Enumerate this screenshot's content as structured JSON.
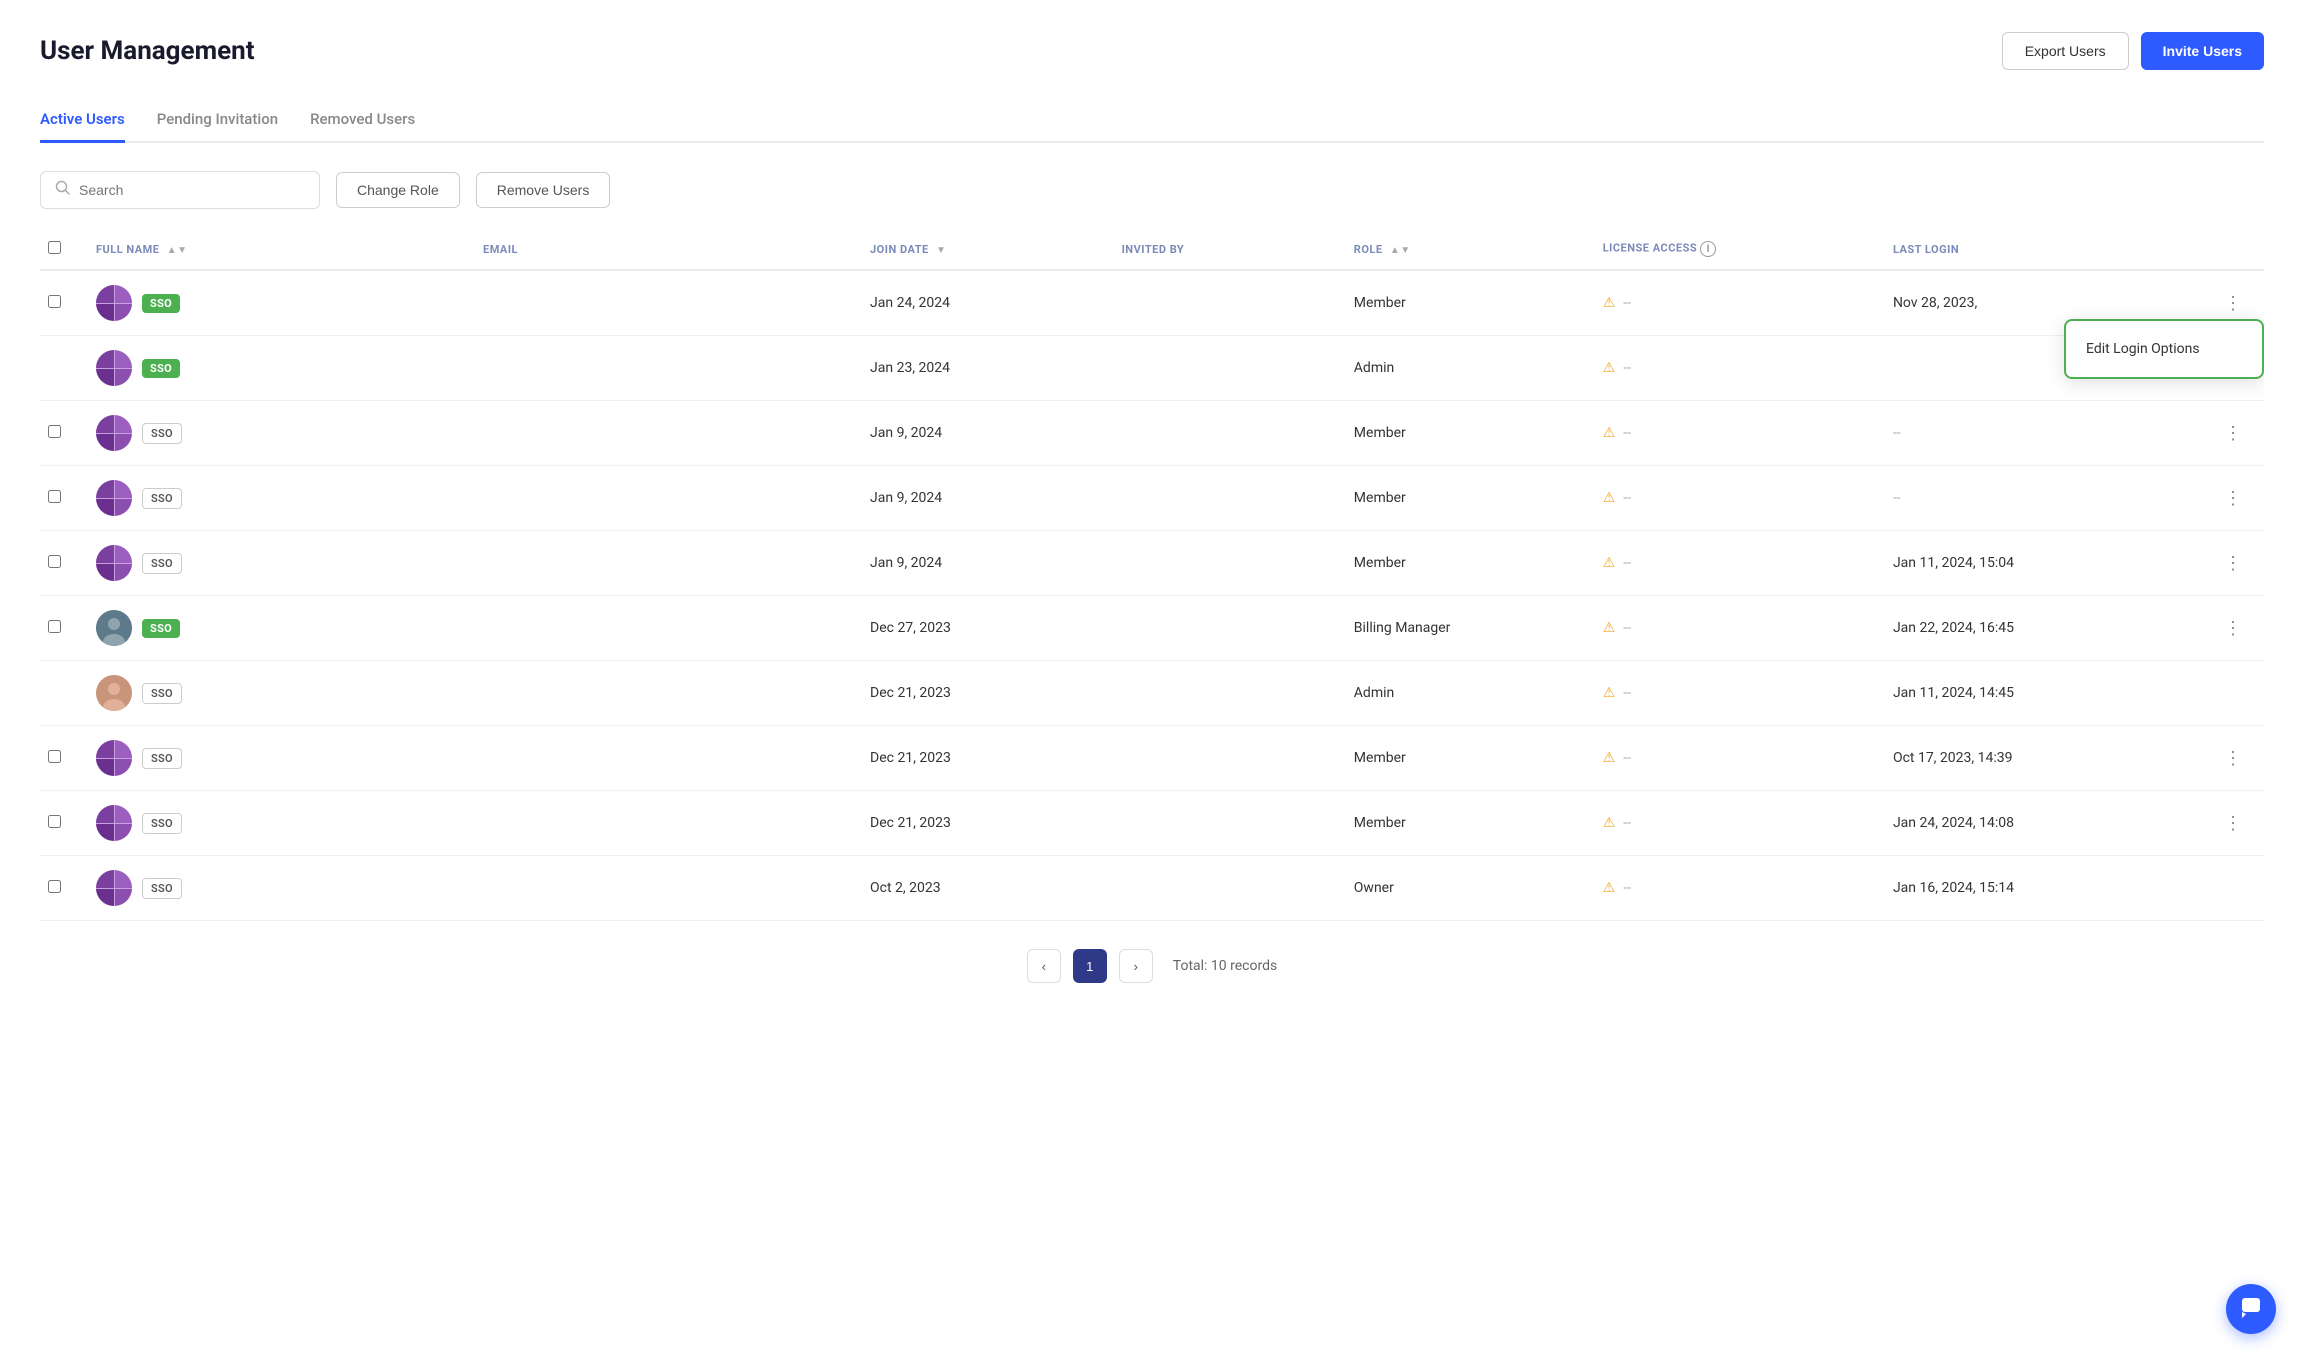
{
  "page": {
    "title": "User Management",
    "export_label": "Export Users",
    "invite_label": "Invite Users"
  },
  "tabs": [
    {
      "id": "active",
      "label": "Active Users",
      "active": true
    },
    {
      "id": "pending",
      "label": "Pending Invitation",
      "active": false
    },
    {
      "id": "removed",
      "label": "Removed Users",
      "active": false
    }
  ],
  "toolbar": {
    "search_placeholder": "Search",
    "change_role_label": "Change Role",
    "remove_users_label": "Remove Users"
  },
  "table": {
    "columns": [
      {
        "id": "fullname",
        "label": "FULL NAME",
        "sortable": true
      },
      {
        "id": "email",
        "label": "EMAIL",
        "sortable": false
      },
      {
        "id": "joindate",
        "label": "JOIN DATE",
        "sortable": true
      },
      {
        "id": "invitedby",
        "label": "INVITED BY",
        "sortable": false
      },
      {
        "id": "role",
        "label": "ROLE",
        "sortable": true
      },
      {
        "id": "license",
        "label": "LICENSE ACCESS",
        "sortable": false,
        "info": true
      },
      {
        "id": "lastlogin",
        "label": "LAST LOGIN",
        "sortable": false
      }
    ],
    "rows": [
      {
        "id": 1,
        "sso": "filled",
        "join_date": "Jan 24, 2024",
        "invited_by": "",
        "role": "Member",
        "license": "--",
        "last_login": "Nov 28, 2023,",
        "has_dropdown": true,
        "has_menu": true,
        "checkbox": true
      },
      {
        "id": 2,
        "sso": "filled",
        "join_date": "Jan 23, 2024",
        "invited_by": "",
        "role": "Admin",
        "license": "--",
        "last_login": "",
        "has_dropdown": false,
        "has_menu": false,
        "checkbox": false
      },
      {
        "id": 3,
        "sso": "outline",
        "join_date": "Jan 9, 2024",
        "invited_by": "",
        "role": "Member",
        "license": "--",
        "last_login": "--",
        "has_dropdown": false,
        "has_menu": true,
        "checkbox": true
      },
      {
        "id": 4,
        "sso": "outline",
        "join_date": "Jan 9, 2024",
        "invited_by": "",
        "role": "Member",
        "license": "--",
        "last_login": "--",
        "has_dropdown": false,
        "has_menu": true,
        "checkbox": true
      },
      {
        "id": 5,
        "sso": "outline",
        "join_date": "Jan 9, 2024",
        "invited_by": "",
        "role": "Member",
        "license": "--",
        "last_login": "Jan 11, 2024, 15:04",
        "has_dropdown": false,
        "has_menu": true,
        "checkbox": true
      },
      {
        "id": 6,
        "sso": "filled",
        "join_date": "Dec 27, 2023",
        "invited_by": "",
        "role": "Billing Manager",
        "license": "--",
        "last_login": "Jan 22, 2024, 16:45",
        "has_dropdown": false,
        "has_menu": true,
        "checkbox": true,
        "avatar_type": "photo_male"
      },
      {
        "id": 7,
        "sso": "outline",
        "join_date": "Dec 21, 2023",
        "invited_by": "",
        "role": "Admin",
        "license": "--",
        "last_login": "Jan 11, 2024, 14:45",
        "has_dropdown": false,
        "has_menu": false,
        "checkbox": false,
        "avatar_type": "photo_female"
      },
      {
        "id": 8,
        "sso": "outline",
        "join_date": "Dec 21, 2023",
        "invited_by": "",
        "role": "Member",
        "license": "--",
        "last_login": "Oct 17, 2023, 14:39",
        "has_dropdown": false,
        "has_menu": true,
        "checkbox": true
      },
      {
        "id": 9,
        "sso": "outline",
        "join_date": "Dec 21, 2023",
        "invited_by": "",
        "role": "Member",
        "license": "--",
        "last_login": "Jan 24, 2024, 14:08",
        "has_dropdown": false,
        "has_menu": true,
        "checkbox": true
      },
      {
        "id": 10,
        "sso": "outline",
        "join_date": "Oct 2, 2023",
        "invited_by": "",
        "role": "Owner",
        "license": "--",
        "last_login": "Jan 16, 2024, 15:14",
        "has_dropdown": false,
        "has_menu": false,
        "checkbox": true
      }
    ]
  },
  "dropdown": {
    "edit_login_label": "Edit Login Options"
  },
  "pagination": {
    "current_page": 1,
    "total_label": "Total: 10 records"
  }
}
